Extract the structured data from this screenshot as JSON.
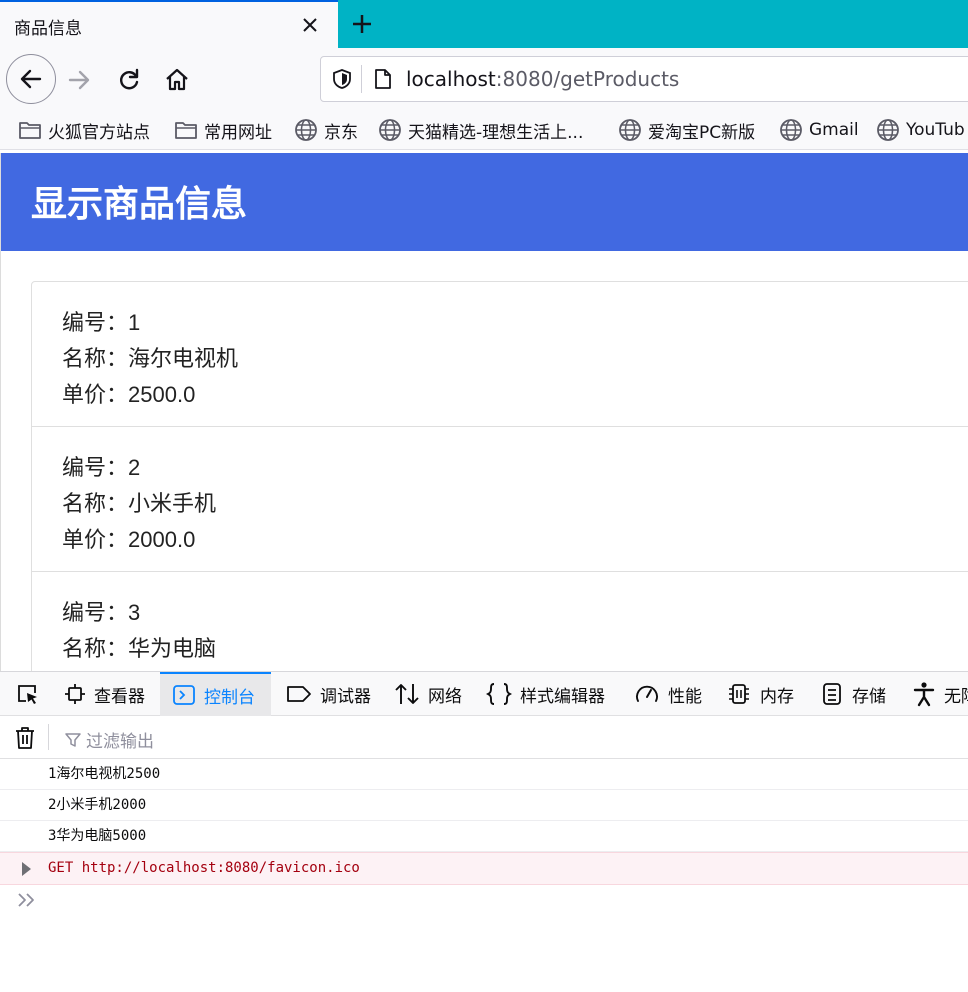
{
  "browser": {
    "tab": {
      "title": "商品信息",
      "close_icon": "close-icon"
    },
    "new_tab_icon": "plus-icon",
    "nav": {
      "back_icon": "arrow-left-icon",
      "forward_icon": "arrow-right-icon",
      "reload_icon": "reload-icon",
      "home_icon": "home-icon"
    },
    "url": {
      "host": "localhost",
      "rest": ":8080/getProducts"
    },
    "bookmarks": [
      {
        "label": "火狐官方站点",
        "icon": "folder-icon"
      },
      {
        "label": "常用网址",
        "icon": "folder-icon"
      },
      {
        "label": "京东",
        "icon": "globe-icon"
      },
      {
        "label": "天猫精选-理想生活上...",
        "icon": "globe-icon"
      },
      {
        "label": "爱淘宝PC新版",
        "icon": "globe-icon"
      },
      {
        "label": "Gmail",
        "icon": "globe-icon"
      },
      {
        "label": "YouTub",
        "icon": "globe-icon"
      }
    ]
  },
  "page": {
    "title": "显示商品信息",
    "labels": {
      "id": "编号：",
      "name": "名称：",
      "price": "单价："
    },
    "products": [
      {
        "id": "1",
        "name": "海尔电视机",
        "price": "2500.0"
      },
      {
        "id": "2",
        "name": "小米手机",
        "price": "2000.0"
      },
      {
        "id": "3",
        "name": "华为电脑",
        "price": ""
      }
    ],
    "header_color": "#4169e1"
  },
  "devtools": {
    "tabs": [
      {
        "label": "",
        "icon": "pick-element-icon"
      },
      {
        "label": "查看器",
        "icon": "inspector-icon"
      },
      {
        "label": "控制台",
        "icon": "console-icon",
        "active": true
      },
      {
        "label": "调试器",
        "icon": "debugger-icon"
      },
      {
        "label": "网络",
        "icon": "network-icon"
      },
      {
        "label": "样式编辑器",
        "icon": "style-editor-icon"
      },
      {
        "label": "性能",
        "icon": "performance-icon"
      },
      {
        "label": "内存",
        "icon": "memory-icon"
      },
      {
        "label": "存储",
        "icon": "storage-icon"
      },
      {
        "label": "无障",
        "icon": "accessibility-icon"
      }
    ],
    "filter_placeholder": "过滤输出",
    "console": [
      {
        "text": "1海尔电视机2500",
        "type": "log"
      },
      {
        "text": "2小米手机2000",
        "type": "log"
      },
      {
        "text": "3华为电脑5000",
        "type": "log"
      },
      {
        "text": "GET http://localhost:8080/favicon.ico",
        "type": "error"
      }
    ],
    "prompt_icon": "double-chevron-icon"
  }
}
